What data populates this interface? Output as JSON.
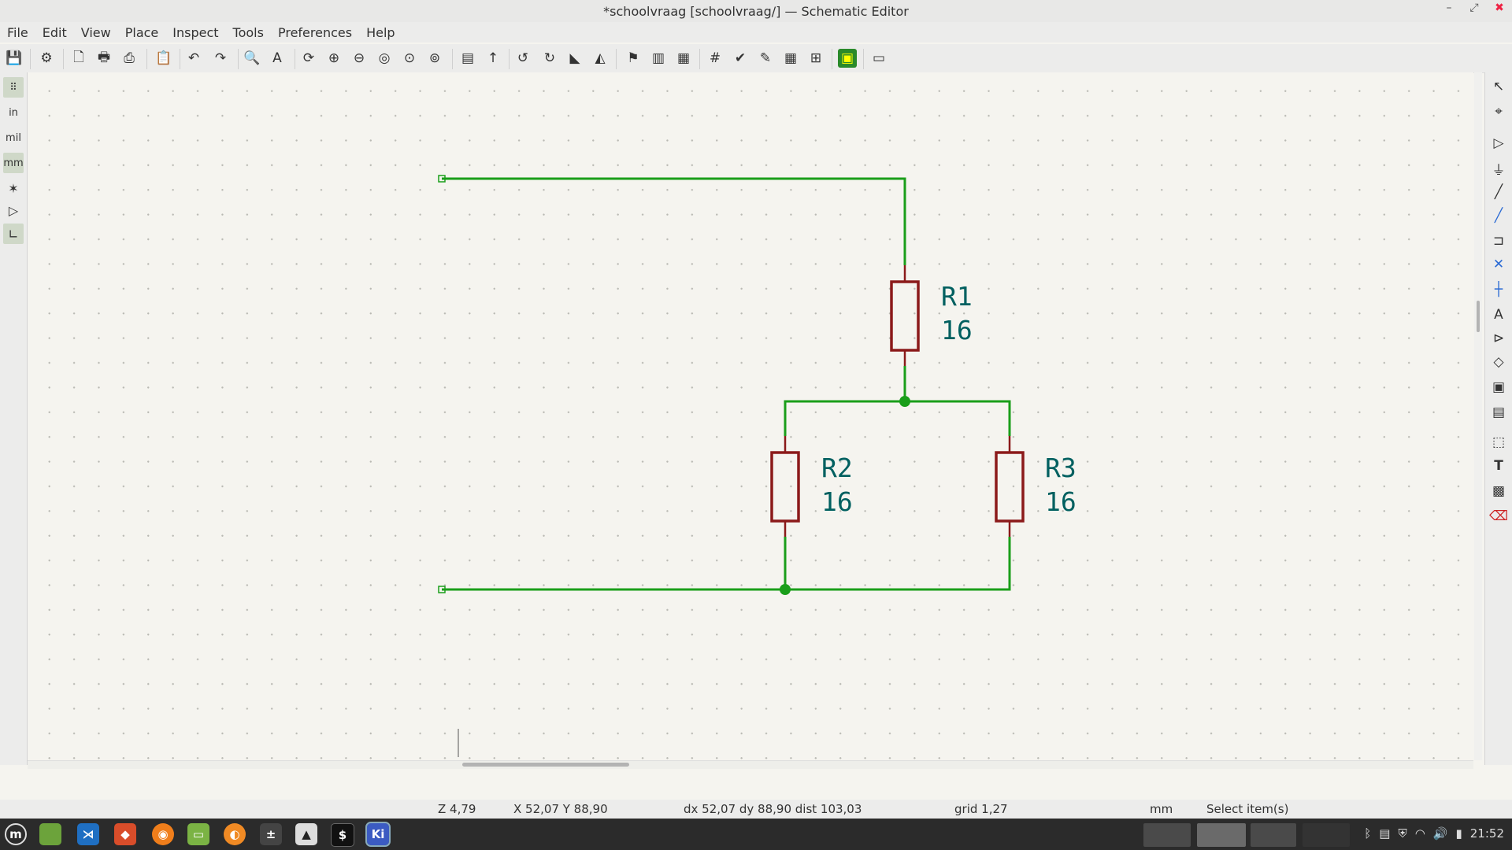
{
  "window": {
    "title": "*schoolvraag [schoolvraag/] — Schematic Editor"
  },
  "menu": [
    "File",
    "Edit",
    "View",
    "Place",
    "Inspect",
    "Tools",
    "Preferences",
    "Help"
  ],
  "left_toolbar": {
    "unit_in": "in",
    "unit_mil": "mil",
    "unit_mm": "mm",
    "active_unit": "mm"
  },
  "schematic": {
    "components": [
      {
        "ref": "R1",
        "value": "16"
      },
      {
        "ref": "R2",
        "value": "16"
      },
      {
        "ref": "R3",
        "value": "16"
      }
    ]
  },
  "statusbar": {
    "zoom": "Z 4,79",
    "coords": "X 52,07  Y 88,90",
    "delta": "dx 52,07  dy 88,90  dist 103,03",
    "grid": "grid 1,27",
    "units": "mm",
    "mode": "Select item(s)"
  },
  "taskbar": {
    "clock": "21:52"
  },
  "colors": {
    "wire": "#1a9e1a",
    "component": "#8b1a1a",
    "label": "#006060",
    "junction": "#1a9e1a"
  }
}
